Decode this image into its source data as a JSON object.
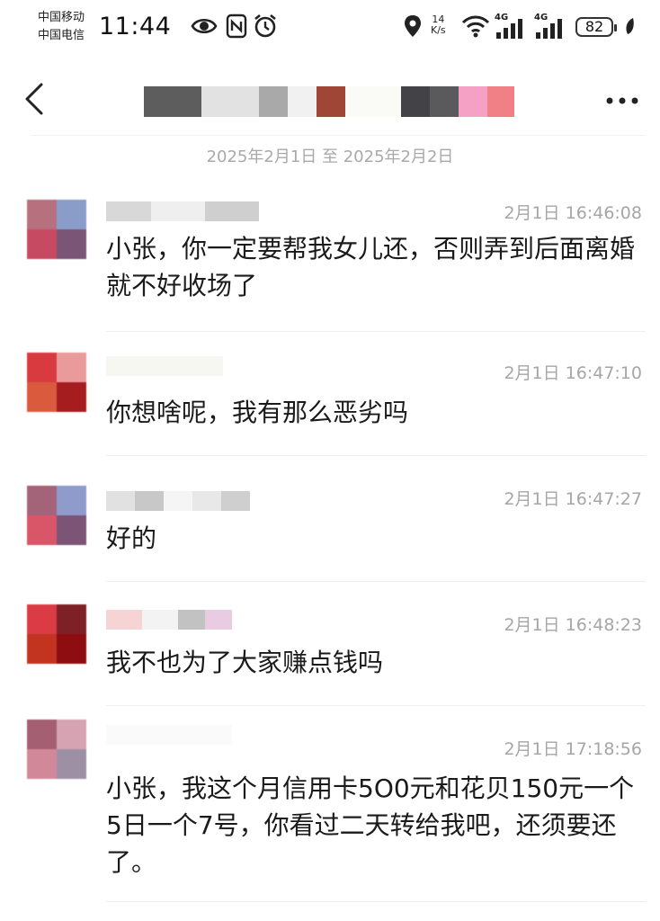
{
  "status_bar": {
    "carrier_1": "中国移动",
    "carrier_2": "中国电信",
    "time": "11:44",
    "net_speed_value": "14",
    "net_speed_unit": "K/s",
    "signal_1_label": "4G",
    "signal_2_label": "4G",
    "battery_level": "82",
    "icons": [
      "eye-icon",
      "nfc-icon",
      "alarm-icon",
      "location-icon",
      "wifi-icon",
      "signal-icon",
      "battery-icon",
      "leaf-icon"
    ]
  },
  "header": {
    "back_icon": "chevron-left-icon",
    "more_icon": "more-dots-icon",
    "title_redacted": true
  },
  "date_range": "2025年2月1日 至 2025年2月2日",
  "messages": [
    {
      "time": "2月1日 16:46:08",
      "text": "小张，你一定要帮我女儿还，否则弄到后面离婚就不好收场了"
    },
    {
      "time": "2月1日 16:47:10",
      "text": "你想啥呢，我有那么恶劣吗"
    },
    {
      "time": "2月1日 16:47:27",
      "text": "好的"
    },
    {
      "time": "2月1日 16:48:23",
      "text": "我不也为了大家赚点钱吗"
    },
    {
      "time": "2月1日 17:18:56",
      "text": "小张，我这个月信用卡5O0元和花贝150元一个5日一个7号，你看过二天转给我吧，还须要还了。"
    }
  ],
  "colors": {
    "time_gray": "#a6a6a6",
    "text_dark": "#1a1a1a",
    "date_gray": "#a9a9a9"
  }
}
